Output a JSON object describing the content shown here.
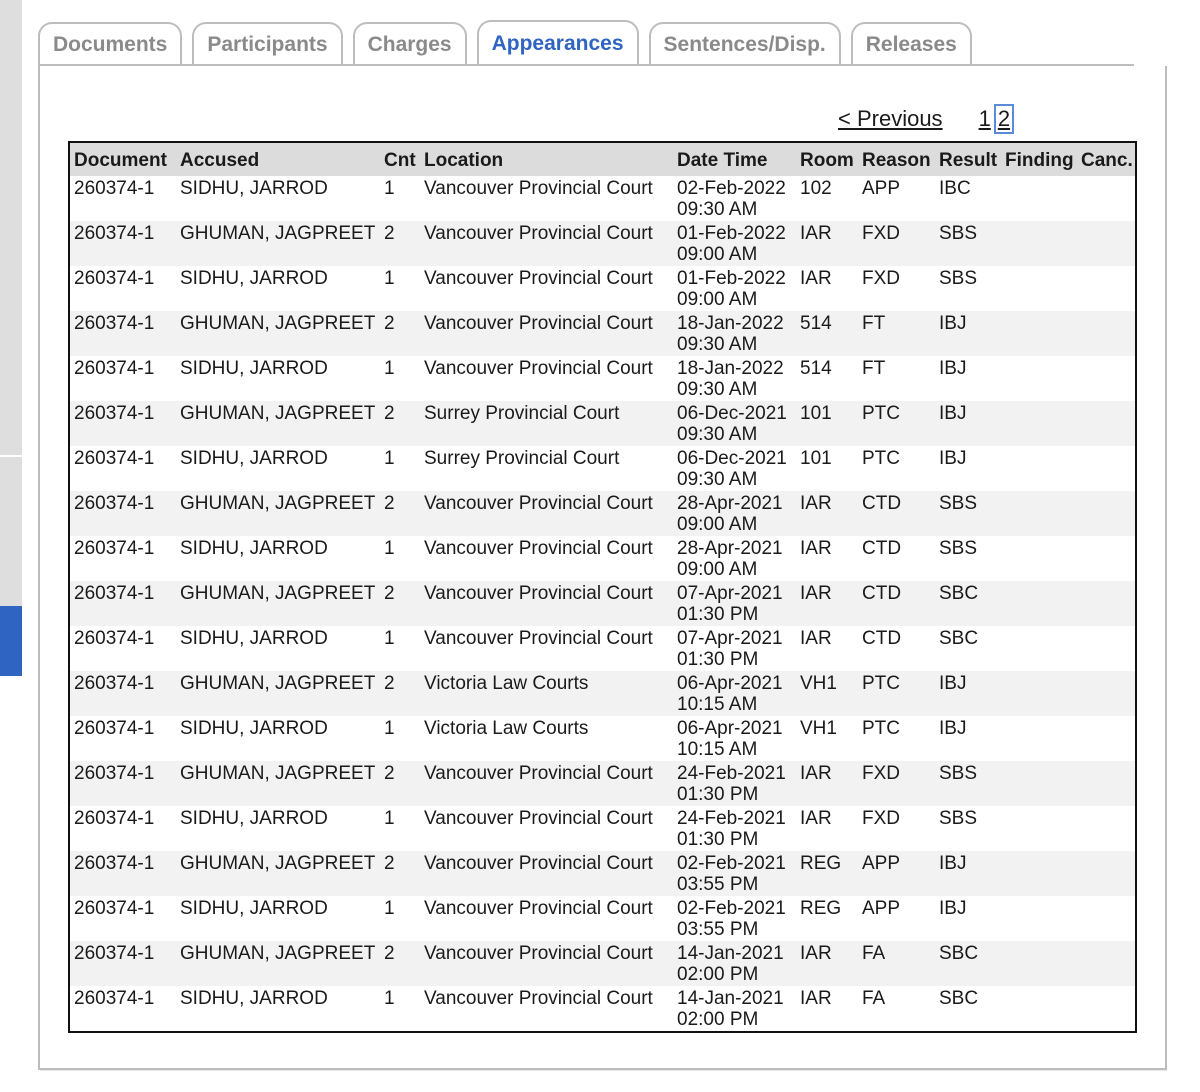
{
  "tabs": [
    {
      "label": "Documents",
      "active": false
    },
    {
      "label": "Participants",
      "active": false
    },
    {
      "label": "Charges",
      "active": false
    },
    {
      "label": "Appearances",
      "active": true
    },
    {
      "label": "Sentences/Disp.",
      "active": false
    },
    {
      "label": "Releases",
      "active": false
    }
  ],
  "pager": {
    "previous_label": "< Previous",
    "pages": [
      "1",
      "2"
    ],
    "current_page": "2"
  },
  "table": {
    "columns": [
      "Document",
      "Accused",
      "Cnt",
      "Location",
      "Date Time",
      "Room",
      "Reason",
      "Result",
      "Finding",
      "Canc."
    ],
    "rows": [
      {
        "document": "260374-1",
        "accused": "SIDHU, JARROD",
        "cnt": "1",
        "location": "Vancouver Provincial Court",
        "date": "02-Feb-2022",
        "time": "09:30 AM",
        "room": "102",
        "reason": "APP",
        "result": "IBC",
        "finding": "",
        "canc": ""
      },
      {
        "document": "260374-1",
        "accused": "GHUMAN, JAGPREET",
        "cnt": "2",
        "location": "Vancouver Provincial Court",
        "date": "01-Feb-2022",
        "time": "09:00 AM",
        "room": "IAR",
        "reason": "FXD",
        "result": "SBS",
        "finding": "",
        "canc": ""
      },
      {
        "document": "260374-1",
        "accused": "SIDHU, JARROD",
        "cnt": "1",
        "location": "Vancouver Provincial Court",
        "date": "01-Feb-2022",
        "time": "09:00 AM",
        "room": "IAR",
        "reason": "FXD",
        "result": "SBS",
        "finding": "",
        "canc": ""
      },
      {
        "document": "260374-1",
        "accused": "GHUMAN, JAGPREET",
        "cnt": "2",
        "location": "Vancouver Provincial Court",
        "date": "18-Jan-2022",
        "time": "09:30 AM",
        "room": "514",
        "reason": "FT",
        "result": "IBJ",
        "finding": "",
        "canc": ""
      },
      {
        "document": "260374-1",
        "accused": "SIDHU, JARROD",
        "cnt": "1",
        "location": "Vancouver Provincial Court",
        "date": "18-Jan-2022",
        "time": "09:30 AM",
        "room": "514",
        "reason": "FT",
        "result": "IBJ",
        "finding": "",
        "canc": ""
      },
      {
        "document": "260374-1",
        "accused": "GHUMAN, JAGPREET",
        "cnt": "2",
        "location": "Surrey Provincial Court",
        "date": "06-Dec-2021",
        "time": "09:30 AM",
        "room": "101",
        "reason": "PTC",
        "result": "IBJ",
        "finding": "",
        "canc": ""
      },
      {
        "document": "260374-1",
        "accused": "SIDHU, JARROD",
        "cnt": "1",
        "location": "Surrey Provincial Court",
        "date": "06-Dec-2021",
        "time": "09:30 AM",
        "room": "101",
        "reason": "PTC",
        "result": "IBJ",
        "finding": "",
        "canc": ""
      },
      {
        "document": "260374-1",
        "accused": "GHUMAN, JAGPREET",
        "cnt": "2",
        "location": "Vancouver Provincial Court",
        "date": "28-Apr-2021",
        "time": "09:00 AM",
        "room": "IAR",
        "reason": "CTD",
        "result": "SBS",
        "finding": "",
        "canc": ""
      },
      {
        "document": "260374-1",
        "accused": "SIDHU, JARROD",
        "cnt": "1",
        "location": "Vancouver Provincial Court",
        "date": "28-Apr-2021",
        "time": "09:00 AM",
        "room": "IAR",
        "reason": "CTD",
        "result": "SBS",
        "finding": "",
        "canc": ""
      },
      {
        "document": "260374-1",
        "accused": "GHUMAN, JAGPREET",
        "cnt": "2",
        "location": "Vancouver Provincial Court",
        "date": "07-Apr-2021",
        "time": "01:30 PM",
        "room": "IAR",
        "reason": "CTD",
        "result": "SBC",
        "finding": "",
        "canc": ""
      },
      {
        "document": "260374-1",
        "accused": "SIDHU, JARROD",
        "cnt": "1",
        "location": "Vancouver Provincial Court",
        "date": "07-Apr-2021",
        "time": "01:30 PM",
        "room": "IAR",
        "reason": "CTD",
        "result": "SBC",
        "finding": "",
        "canc": ""
      },
      {
        "document": "260374-1",
        "accused": "GHUMAN, JAGPREET",
        "cnt": "2",
        "location": "Victoria Law Courts",
        "date": "06-Apr-2021",
        "time": "10:15 AM",
        "room": "VH1",
        "reason": "PTC",
        "result": "IBJ",
        "finding": "",
        "canc": ""
      },
      {
        "document": "260374-1",
        "accused": "SIDHU, JARROD",
        "cnt": "1",
        "location": "Victoria Law Courts",
        "date": "06-Apr-2021",
        "time": "10:15 AM",
        "room": "VH1",
        "reason": "PTC",
        "result": "IBJ",
        "finding": "",
        "canc": ""
      },
      {
        "document": "260374-1",
        "accused": "GHUMAN, JAGPREET",
        "cnt": "2",
        "location": "Vancouver Provincial Court",
        "date": "24-Feb-2021",
        "time": "01:30 PM",
        "room": "IAR",
        "reason": "FXD",
        "result": "SBS",
        "finding": "",
        "canc": ""
      },
      {
        "document": "260374-1",
        "accused": "SIDHU, JARROD",
        "cnt": "1",
        "location": "Vancouver Provincial Court",
        "date": "24-Feb-2021",
        "time": "01:30 PM",
        "room": "IAR",
        "reason": "FXD",
        "result": "SBS",
        "finding": "",
        "canc": ""
      },
      {
        "document": "260374-1",
        "accused": "GHUMAN, JAGPREET",
        "cnt": "2",
        "location": "Vancouver Provincial Court",
        "date": "02-Feb-2021",
        "time": "03:55 PM",
        "room": "REG",
        "reason": "APP",
        "result": "IBJ",
        "finding": "",
        "canc": ""
      },
      {
        "document": "260374-1",
        "accused": "SIDHU, JARROD",
        "cnt": "1",
        "location": "Vancouver Provincial Court",
        "date": "02-Feb-2021",
        "time": "03:55 PM",
        "room": "REG",
        "reason": "APP",
        "result": "IBJ",
        "finding": "",
        "canc": ""
      },
      {
        "document": "260374-1",
        "accused": "GHUMAN, JAGPREET",
        "cnt": "2",
        "location": "Vancouver Provincial Court",
        "date": "14-Jan-2021",
        "time": "02:00 PM",
        "room": "IAR",
        "reason": "FA",
        "result": "SBC",
        "finding": "",
        "canc": ""
      },
      {
        "document": "260374-1",
        "accused": "SIDHU, JARROD",
        "cnt": "1",
        "location": "Vancouver Provincial Court",
        "date": "14-Jan-2021",
        "time": "02:00 PM",
        "room": "IAR",
        "reason": "FA",
        "result": "SBC",
        "finding": "",
        "canc": ""
      }
    ]
  },
  "colors": {
    "accent": "#2f64c2",
    "tab_inactive_text": "#8a8a8a",
    "header_bg": "#dcdcdc",
    "row_alt_bg": "#f2f2f2",
    "border": "#bdbdbd",
    "sidebar_gray": "#dedede"
  }
}
